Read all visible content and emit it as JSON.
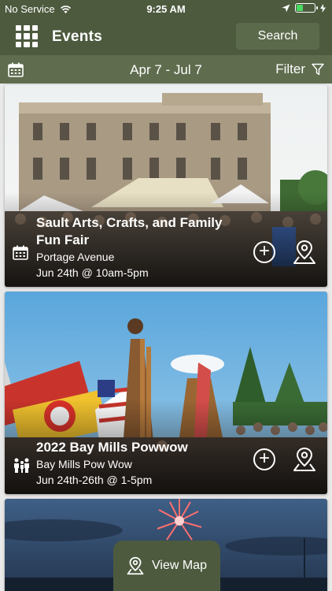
{
  "status_bar": {
    "carrier": "No Service",
    "time": "9:25 AM",
    "battery_level": 0.4
  },
  "header": {
    "title": "Events",
    "search_label": "Search"
  },
  "date_bar": {
    "range": "Apr 7  -  Jul 7",
    "filter_label": "Filter"
  },
  "events": [
    {
      "name": "Sault Arts, Crafts, and Family Fun Fair",
      "location": "Portage Avenue",
      "when": "Jun 24th @ 10am-5pm",
      "category_icon": "calendar-icon"
    },
    {
      "name": "2022 Bay Mills Powwow",
      "location": "Bay Mills Pow Wow",
      "when": "Jun 24th-26th @ 1-5pm",
      "category_icon": "family-icon"
    }
  ],
  "map_button": {
    "label": "View Map"
  },
  "colors": {
    "header_bg": "#4d5a3e",
    "date_bar_bg": "#5f6c4e",
    "battery_fill": "#4cd964"
  }
}
